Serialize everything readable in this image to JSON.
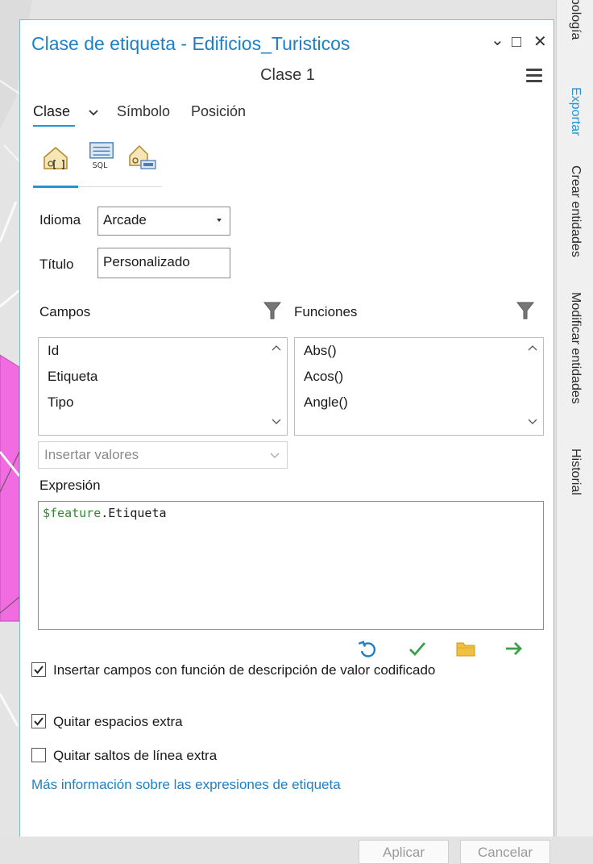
{
  "window": {
    "title": "Clase de etiqueta - Edificios_Turisticos",
    "class_name": "Clase 1",
    "controls": {
      "dropdown": "⌄",
      "maximize": "□",
      "close": "✕"
    }
  },
  "tabs": [
    {
      "label": "Clase"
    },
    {
      "label": "Símbolo"
    },
    {
      "label": "Posición"
    }
  ],
  "subtab_icons": [
    "label-expression-icon",
    "sql-query-icon",
    "label-placement-icon"
  ],
  "language": {
    "label": "Idioma",
    "value": "Arcade"
  },
  "title_field": {
    "label": "Título",
    "value": "Personalizado"
  },
  "fields": {
    "header": "Campos",
    "items": [
      "Id",
      "Etiqueta",
      "Tipo"
    ]
  },
  "functions": {
    "header": "Funciones",
    "items": [
      "Abs()",
      "Acos()",
      "Angle()"
    ]
  },
  "insert_values": {
    "placeholder": "Insertar valores"
  },
  "expression": {
    "label": "Expresión",
    "keyword": "$feature",
    "rest": ".Etiqueta"
  },
  "options": [
    {
      "label": "Insertar campos con función de descripción de valor codificado",
      "checked": true
    },
    {
      "label": "Quitar espacios extra",
      "checked": true
    },
    {
      "label": "Quitar saltos de línea extra",
      "checked": false
    }
  ],
  "help_link": "Más información sobre las expresiones de etiqueta",
  "buttons": {
    "apply": "Aplicar",
    "cancel": "Cancelar"
  },
  "side_panel_tabs": [
    {
      "label": "nbología",
      "active": false
    },
    {
      "label": "Exportar",
      "active": true
    },
    {
      "label": "Crear entidades",
      "active": false
    },
    {
      "label": "Modificar entidades",
      "active": false
    },
    {
      "label": "Historial",
      "active": false
    }
  ],
  "colors": {
    "accent": "#2196d4",
    "title": "#1d7fc4",
    "keyword": "#2e8b2e",
    "map_polygon": "#f06ce0"
  }
}
